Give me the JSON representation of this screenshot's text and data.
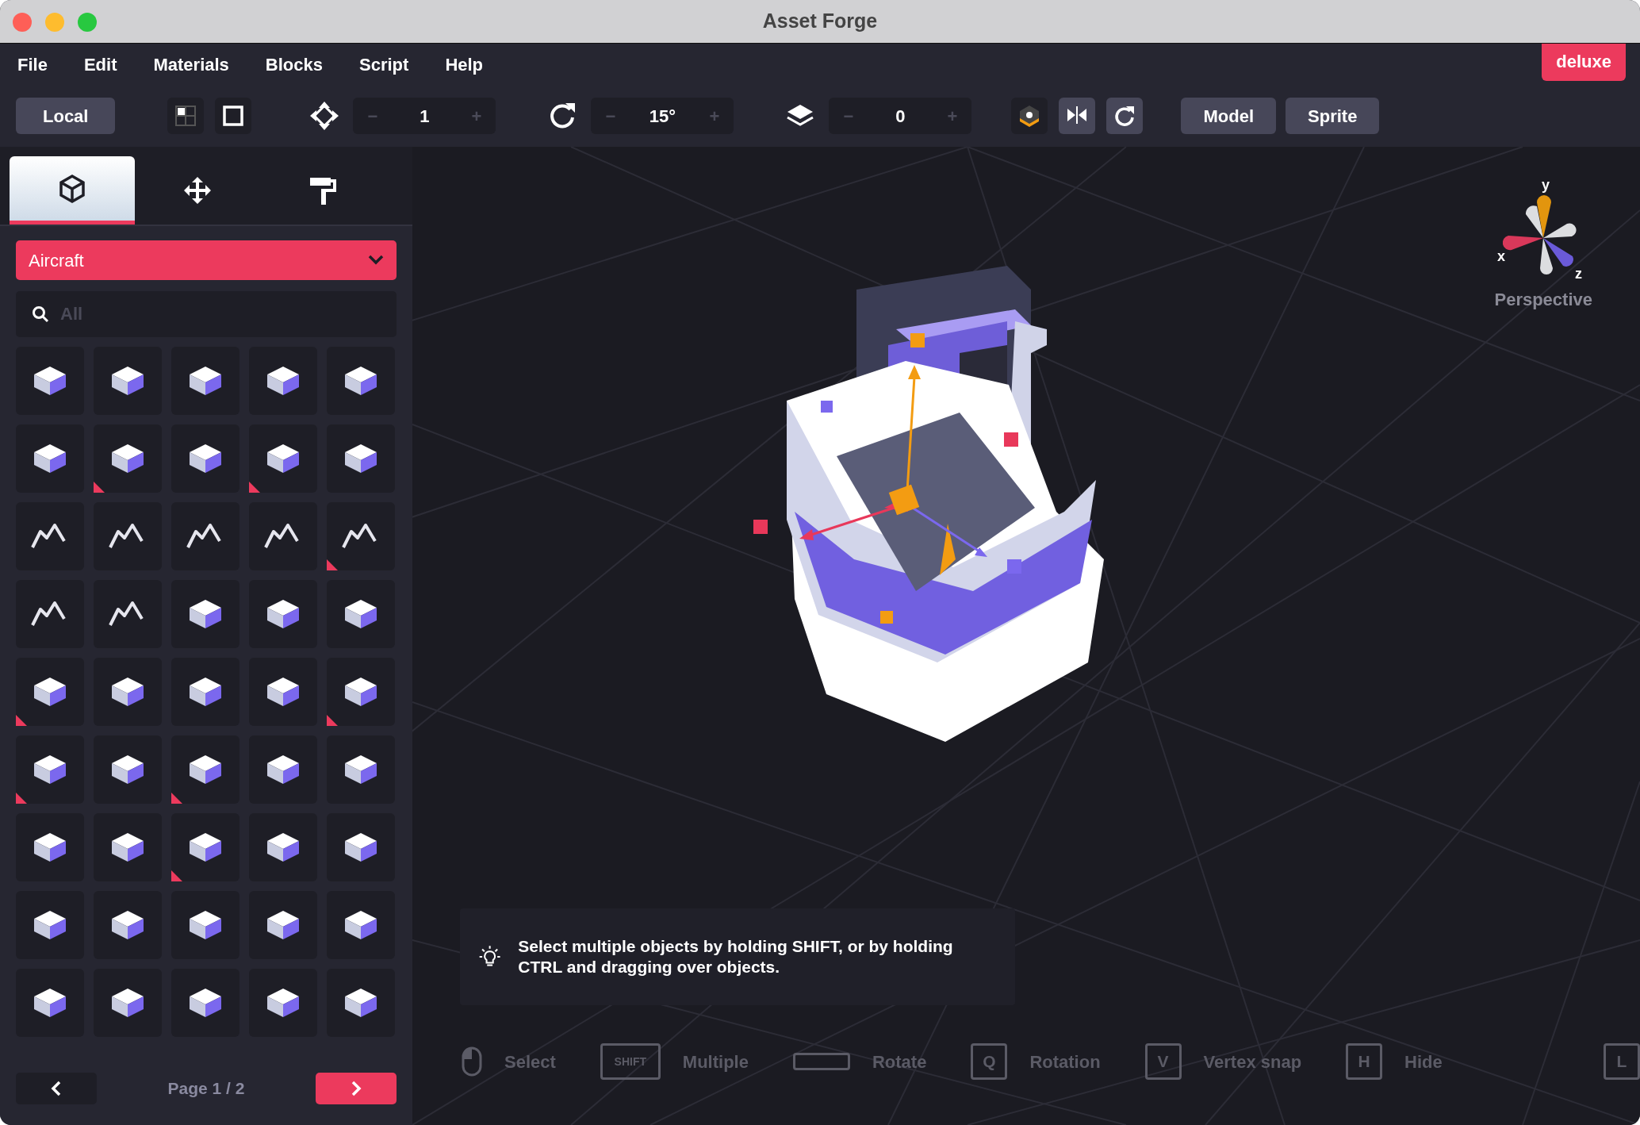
{
  "window": {
    "title": "Asset Forge"
  },
  "menu": [
    "File",
    "Edit",
    "Materials",
    "Blocks",
    "Script",
    "Help"
  ],
  "badge": "deluxe",
  "toolbar": {
    "space_button": "Local",
    "view_buttons": [
      {
        "kind": "quad"
      },
      {
        "kind": "single"
      }
    ],
    "steppers": [
      {
        "kind": "move",
        "minus": "−",
        "value": "1",
        "plus": "+"
      },
      {
        "kind": "rotate",
        "minus": "−",
        "value": "15°",
        "plus": "+"
      },
      {
        "kind": "layers",
        "minus": "−",
        "value": "0",
        "plus": "+"
      }
    ],
    "tool_buttons": [
      {
        "kind": "pivot"
      },
      {
        "kind": "mirror"
      },
      {
        "kind": "reset"
      }
    ],
    "mode_buttons": [
      "Model",
      "Sprite"
    ]
  },
  "sidebar": {
    "tabs": [
      {
        "kind": "blocks",
        "selected": true
      },
      {
        "kind": "move",
        "selected": false
      },
      {
        "kind": "paint",
        "selected": false
      }
    ],
    "category": "Aircraft",
    "search": {
      "placeholder": "All"
    },
    "tiles": [
      {
        "kind": "solid",
        "marked": false
      },
      {
        "kind": "solid",
        "marked": false
      },
      {
        "kind": "solid",
        "marked": false
      },
      {
        "kind": "solid",
        "marked": false
      },
      {
        "kind": "solid",
        "marked": false
      },
      {
        "kind": "solid",
        "marked": false
      },
      {
        "kind": "solid",
        "marked": true
      },
      {
        "kind": "solid",
        "marked": false
      },
      {
        "kind": "solid",
        "marked": true
      },
      {
        "kind": "solid",
        "marked": false
      },
      {
        "kind": "wire",
        "marked": false
      },
      {
        "kind": "wire",
        "marked": false
      },
      {
        "kind": "wire",
        "marked": false
      },
      {
        "kind": "wire",
        "marked": false
      },
      {
        "kind": "wire",
        "marked": true
      },
      {
        "kind": "wire",
        "marked": false
      },
      {
        "kind": "wire",
        "marked": false
      },
      {
        "kind": "solid",
        "marked": false
      },
      {
        "kind": "solid",
        "marked": false
      },
      {
        "kind": "solid",
        "marked": false
      },
      {
        "kind": "solid",
        "marked": true
      },
      {
        "kind": "solid",
        "marked": false
      },
      {
        "kind": "solid",
        "marked": false
      },
      {
        "kind": "solid",
        "marked": false
      },
      {
        "kind": "solid",
        "marked": true
      },
      {
        "kind": "solid",
        "marked": true
      },
      {
        "kind": "solid",
        "marked": false
      },
      {
        "kind": "solid",
        "marked": true
      },
      {
        "kind": "solid",
        "marked": false
      },
      {
        "kind": "solid",
        "marked": false
      },
      {
        "kind": "solid",
        "marked": false
      },
      {
        "kind": "solid",
        "marked": false
      },
      {
        "kind": "solid",
        "marked": true
      },
      {
        "kind": "solid",
        "marked": false
      },
      {
        "kind": "solid",
        "marked": false
      },
      {
        "kind": "solid",
        "marked": false
      },
      {
        "kind": "solid",
        "marked": false
      },
      {
        "kind": "solid",
        "marked": false
      },
      {
        "kind": "solid",
        "marked": false
      },
      {
        "kind": "solid",
        "marked": false
      },
      {
        "kind": "solid",
        "marked": false
      },
      {
        "kind": "solid",
        "marked": false
      },
      {
        "kind": "solid",
        "marked": false
      },
      {
        "kind": "solid",
        "marked": false
      },
      {
        "kind": "solid",
        "marked": false
      }
    ],
    "pagination": {
      "prev_disabled": true,
      "page": "Page 1 / 2",
      "next_disabled": false
    }
  },
  "viewport": {
    "axis_labels": [
      "y",
      "x",
      "z"
    ],
    "view": "Perspective",
    "tip": "Select multiple objects by holding SHIFT, or by holding CTRL and dragging over objects.",
    "hints": [
      {
        "kind": "mouse",
        "label": "Select"
      },
      {
        "kind": "key",
        "key": "SHIFT",
        "label": "Multiple"
      },
      {
        "kind": "spacebar",
        "label": "Rotate"
      },
      {
        "kind": "key",
        "key": "Q",
        "label": "Rotation"
      },
      {
        "kind": "key",
        "key": "V",
        "label": "Vertex snap"
      },
      {
        "kind": "key",
        "key": "H",
        "label": "Hide"
      },
      {
        "kind": "key",
        "key": "L"
      }
    ]
  }
}
